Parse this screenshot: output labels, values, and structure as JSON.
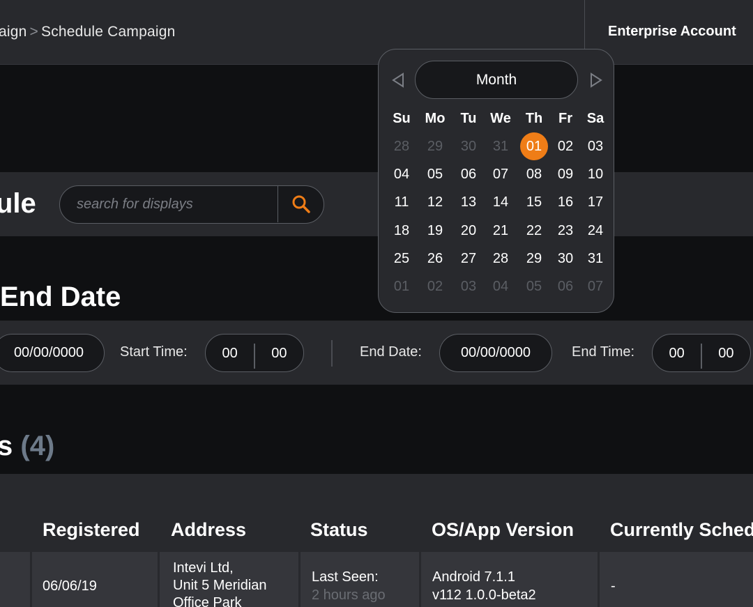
{
  "header": {
    "breadcrumb_prev": "aign",
    "breadcrumb_sep": ">",
    "breadcrumb_current": "Schedule Campaign",
    "account": "Enterprise Account"
  },
  "schedule": {
    "title": "ule",
    "search_placeholder": "search for displays",
    "search_icon": "magnifier-icon",
    "accent": "#ef7d17"
  },
  "dates": {
    "title": "End Date",
    "start_date_value": "00/00/0000",
    "start_time_label": "Start Time:",
    "start_hour": "00",
    "start_minute": "00",
    "end_date_label": "End Date:",
    "end_date_value": "00/00/0000",
    "end_time_label": "End Time:",
    "end_hour": "00",
    "end_minute": "00"
  },
  "displays": {
    "title": "s",
    "count": "(4)"
  },
  "table": {
    "columns": [
      "Registered",
      "Address",
      "Status",
      "OS/App Version",
      "Currently Sched"
    ],
    "row": {
      "registered": "06/06/19",
      "address_line1": "Intevi Ltd,",
      "address_line2": "Unit 5 Meridian",
      "address_line3": "Office Park",
      "status_line1": "Last Seen:",
      "status_line2": "2 hours ago",
      "os_line1": "Android 7.1.1",
      "os_line2": "v112 1.0.0-beta2",
      "scheduled": "-"
    }
  },
  "calendar": {
    "month_label": "Month",
    "prev_icon": "triangle-left-icon",
    "next_icon": "triangle-right-icon",
    "weekdays": [
      "Su",
      "Mo",
      "Tu",
      "We",
      "Th",
      "Fr",
      "Sa"
    ],
    "weeks": [
      [
        "28",
        "29",
        "30",
        "31",
        "01",
        "02",
        "03"
      ],
      [
        "04",
        "05",
        "06",
        "07",
        "08",
        "09",
        "10"
      ],
      [
        "11",
        "12",
        "13",
        "14",
        "15",
        "16",
        "17"
      ],
      [
        "18",
        "19",
        "20",
        "21",
        "22",
        "23",
        "24"
      ],
      [
        "25",
        "26",
        "27",
        "28",
        "29",
        "30",
        "31"
      ],
      [
        "01",
        "02",
        "03",
        "04",
        "05",
        "06",
        "07"
      ]
    ],
    "leading_other_month_days": 4,
    "trailing_other_month_days": 7,
    "selected_day": "01"
  }
}
